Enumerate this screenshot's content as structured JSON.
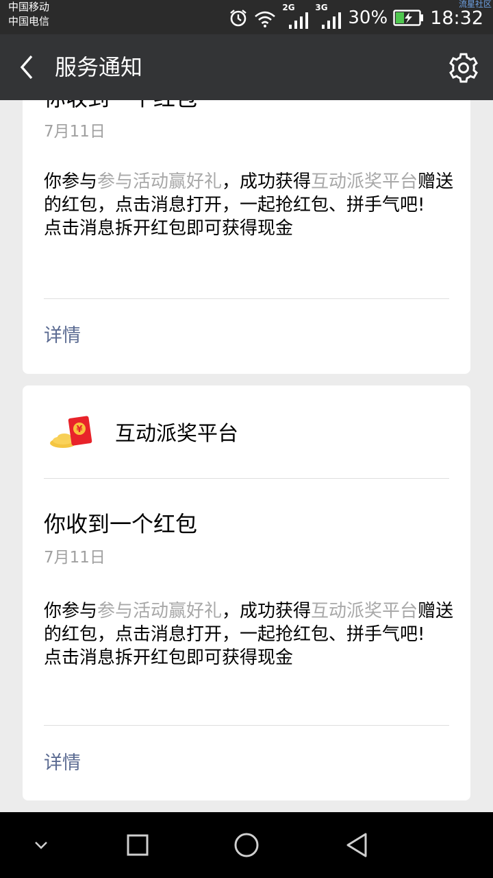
{
  "status_bar": {
    "carrier_1": "中国移动",
    "carrier_2": "中国电信",
    "watermark": "流星社区",
    "network_1": "2G",
    "network_2": "3G",
    "battery": "30%",
    "time": "18:32"
  },
  "title_bar": {
    "title": "服务通知",
    "back_icon": "back-arrow-icon",
    "settings_icon": "gear-icon"
  },
  "messages": [
    {
      "title": "你收到一个红包",
      "date": "7月11日",
      "body": {
        "p1": "你参与",
        "link_activity": "参与活动赢好礼",
        "p2": "，成功获得",
        "link_platform": "互动派奖平台",
        "p3": "赠送的红包，点击消息打开，一起抢红包、拼手气吧!",
        "line2": "点击消息拆开红包即可获得现金"
      },
      "detail_label": "详情"
    },
    {
      "source": "互动派奖平台",
      "title": "你收到一个红包",
      "date": "7月11日",
      "body": {
        "p1": "你参与",
        "link_activity": "参与活动赢好礼",
        "p2": "，成功获得",
        "link_platform": "互动派奖平台",
        "p3": "赠送的红包，点击消息打开，一起抢红包、拼手气吧!",
        "line2": "点击消息拆开红包即可获得现金"
      },
      "detail_label": "详情"
    }
  ],
  "nav_bar": {
    "icons": [
      "chevron-down-icon",
      "recent-apps-icon",
      "home-icon",
      "back-triangle-icon"
    ]
  },
  "colors": {
    "title_bar": "#333436",
    "status_bar": "#2b2b2b",
    "background": "#ececec",
    "link_gray": "#a8a8a8",
    "detail_blue": "#5b6b92"
  }
}
